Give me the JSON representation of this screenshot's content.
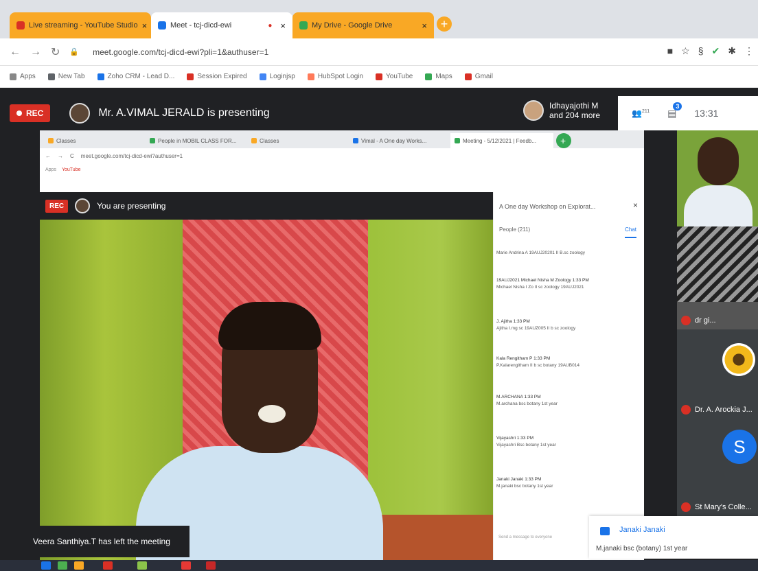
{
  "browser": {
    "tabs": [
      {
        "title": "Live streaming - YouTube Studio",
        "color": "#f9a825",
        "favicon": "#d93025"
      },
      {
        "title": "Meet - tcj-dicd-ewi",
        "color": "#ffffff",
        "favicon": "#1a73e8"
      },
      {
        "title": "My Drive - Google Drive",
        "color": "#f9a825",
        "favicon": "#34a853"
      }
    ],
    "url": "meet.google.com/tcj-dicd-ewi?pli=1&authuser=1",
    "bookmarks": [
      {
        "label": "Apps",
        "color": "#888888"
      },
      {
        "label": "New Tab",
        "color": "#5f6368"
      },
      {
        "label": "Zoho CRM - Lead D...",
        "color": "#1a73e8"
      },
      {
        "label": "Session Expired",
        "color": "#d93025"
      },
      {
        "label": "Loginjsp",
        "color": "#4285f4"
      },
      {
        "label": "HubSpot Login",
        "color": "#ff7a59"
      },
      {
        "label": "YouTube",
        "color": "#d93025"
      },
      {
        "label": "Maps",
        "color": "#34a853"
      },
      {
        "label": "Gmail",
        "color": "#d93025"
      }
    ]
  },
  "meet": {
    "rec_label": "REC",
    "presenter_text": "Mr. A.VIMAL JERALD is presenting",
    "viewers_line1": "Idhayajothi M",
    "viewers_line2": "and 204 more",
    "people_count": "211",
    "chat_count": "3",
    "time": "13:31"
  },
  "shared_screen": {
    "tabs": [
      "Classes",
      "People in MOBIL CLASS FOR...",
      "Classes",
      "Vimal - A One day Works...",
      "Meeting - 5/12/2021 | Feedb..."
    ],
    "url": "meet.google.com/tcj-dicd-ewi?authuser=1",
    "bookmarks": [
      "Apps",
      "YouTube"
    ],
    "rec_label": "REC",
    "presenting_label": "You are presenting",
    "chat_title": "A One day Workshop on Explorat...",
    "people_tab": "People (211)",
    "chat_tab": "Chat",
    "messages": [
      {
        "name": "",
        "text": "Marie Andrina A 19AUJ20201 II B.sc zoology"
      },
      {
        "name": "19AUJ2021 Michael Nisha M Zoology 1:33 PM",
        "text": "Michael Nisha I Zo II sc zoology 19AUJ2021"
      },
      {
        "name": "J. Ajitha 1:33 PM",
        "text": "Ajitha I.mg sc 19AUZ005 II b sc zoology"
      },
      {
        "name": "Kala Rengitham P 1:33 PM",
        "text": "P.Kalarengitham II b sc botany 19AUB014"
      },
      {
        "name": "M.ARCHANA 1:33 PM",
        "text": "M.archana bsc botany 1st year"
      },
      {
        "name": "Vijayashri 1:33 PM",
        "text": "Vijayashri Bsc botany 1st year"
      },
      {
        "name": "Janaki Janaki 1:33 PM",
        "text": "M.janaki bsc botany 1st year"
      }
    ],
    "input_placeholder": "Send a message to everyone"
  },
  "participants": [
    {
      "name": "",
      "type": "video"
    },
    {
      "name": "dr gi...",
      "type": "video"
    },
    {
      "name": "Dr. A. Arockia J...",
      "type": "image"
    },
    {
      "name": "St Mary's Colle...",
      "type": "letter",
      "letter": "S"
    }
  ],
  "toast": "Veera Santhiya.T has left the meeting",
  "notification": {
    "name": "Janaki Janaki",
    "message": "M.janaki bsc (botany) 1st year"
  }
}
